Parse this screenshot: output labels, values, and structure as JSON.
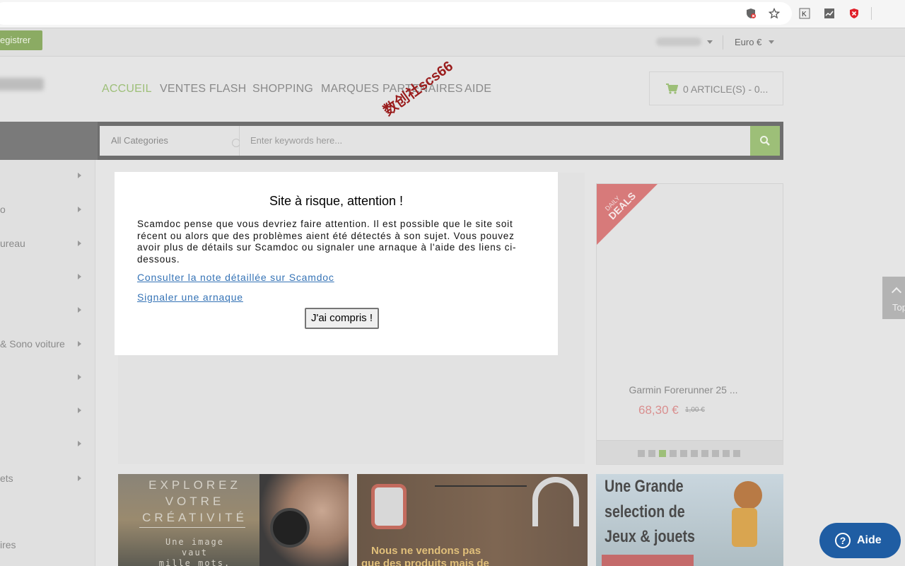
{
  "browser": {
    "icons": [
      "shield-blocked-icon",
      "star-icon",
      "k-extension-icon",
      "chart-extension-icon",
      "red-shield-extension-icon"
    ]
  },
  "topbar": {
    "register_label": "egistrer",
    "currency_label": "Euro €"
  },
  "nav": {
    "items": [
      "ACCUEIL",
      "VENTES FLASH",
      "SHOPPING",
      "MARQUES PARTENAIRES",
      "AIDE"
    ],
    "active_index": 0
  },
  "cart": {
    "label": "0 ARTICLE(S) - 0..."
  },
  "search": {
    "category_label": "All Categories",
    "placeholder": "Enter keywords here..."
  },
  "sidebar": {
    "items": [
      "",
      "o",
      "ureau",
      "",
      "",
      "& Sono voiture",
      "",
      "",
      "",
      "ets",
      "",
      "ires"
    ]
  },
  "deal": {
    "ribbon_line1": "DAILY",
    "ribbon_line2": "DEALS",
    "title": "Garmin Forerunner 25 ...",
    "price": "68,30 €",
    "old_price": "1,00 €",
    "dots_total": 10,
    "dot_active": 2
  },
  "banners": {
    "b1_lines": [
      "EXPLOREZ",
      "VOTRE",
      "CRÉATIVITÉ"
    ],
    "b1_small": [
      "Une image",
      "vaut",
      "mille mots."
    ],
    "b2_line1": "Nous ne vendons pas",
    "b2_line2": "que des produits mais de",
    "b3_lines": [
      "Une Grande",
      "selection de",
      "Jeux & jouets"
    ]
  },
  "totop": {
    "label": "Top"
  },
  "help": {
    "label": "Aide"
  },
  "modal": {
    "title": "Site à risque, attention !",
    "body": "Scamdoc pense que vous devriez faire attention. Il est possible que le site soit récent ou alors que des problèmes aient été détectés à son sujet. Vous pouvez avoir plus de détails sur Scamdoc ou signaler une arnaque à l'aide des liens ci-dessous.",
    "link1": "Consulter la note détaillée sur Scamdoc",
    "link2": "Signaler une arnaque",
    "button": "J'ai compris !"
  },
  "watermark": "数创社scs66",
  "colors": {
    "accent_green": "#9dbf78",
    "help_blue": "#1f5da3",
    "link_blue": "#3573b6",
    "price_red": "#d98f8f"
  }
}
